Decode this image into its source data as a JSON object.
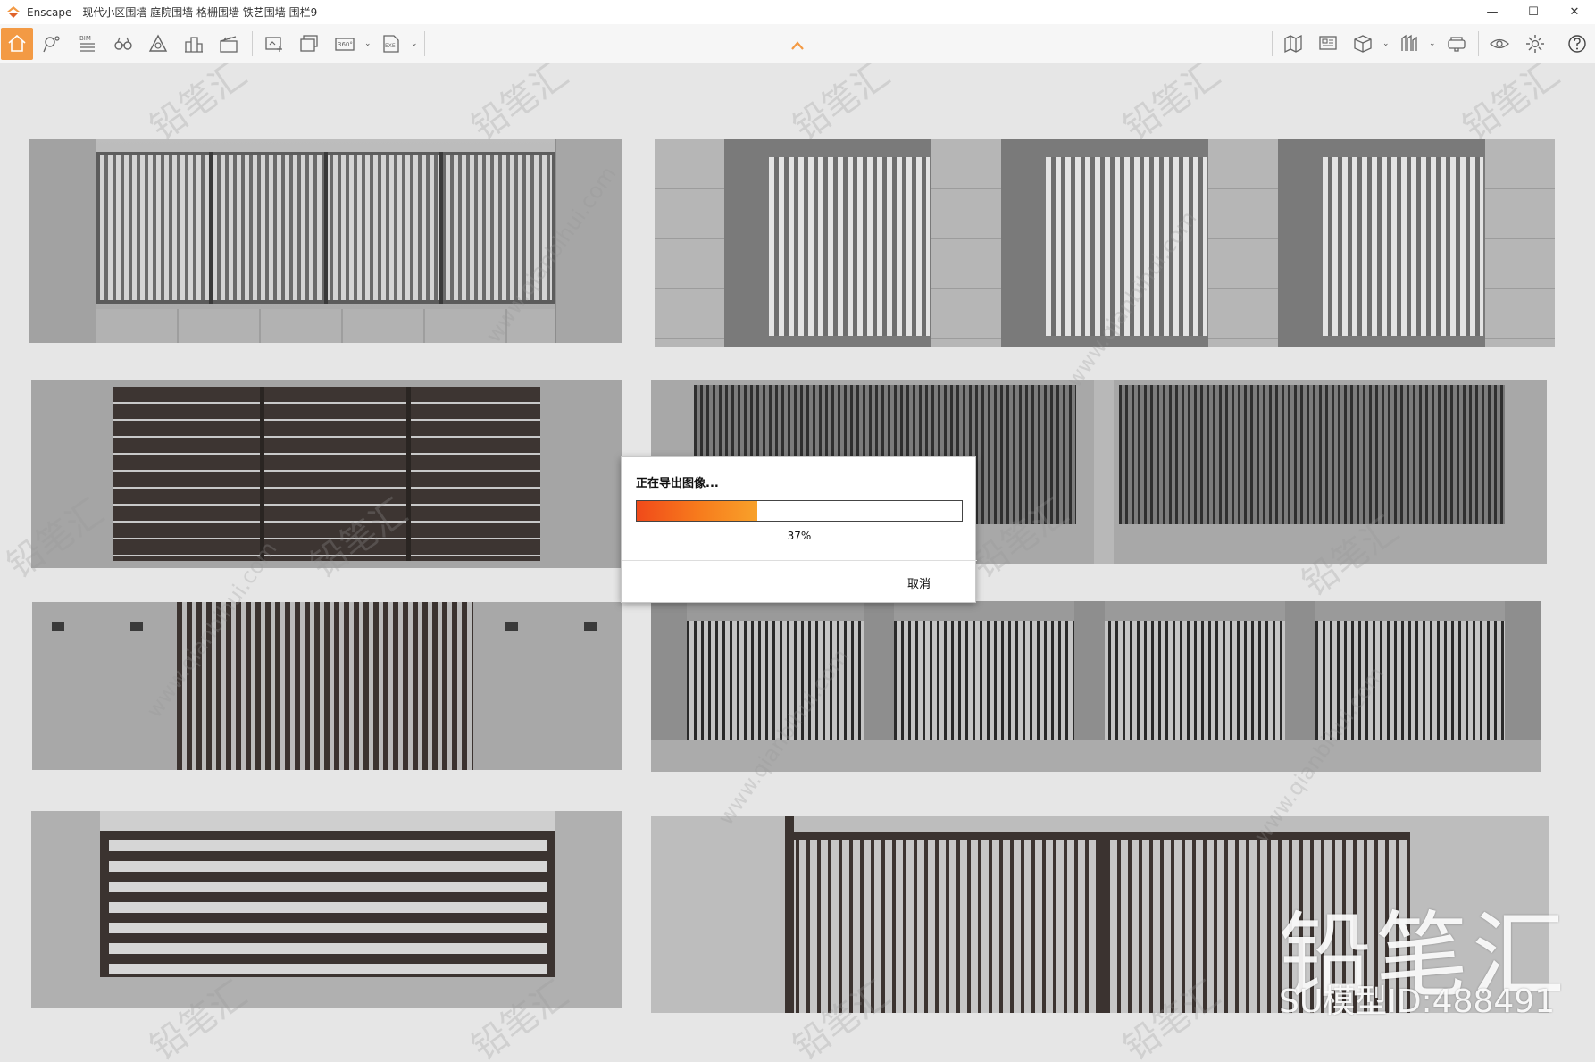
{
  "window": {
    "title": "Enscape - 现代小区围墙 庭院围墙 格栅围墙 铁艺围墙 围栏9",
    "minimize": "—",
    "maximize": "☐",
    "close": "✕"
  },
  "toolbar": {
    "bim_label": "BIM",
    "items_left": [
      "home-icon",
      "location-pin-icon",
      "bim-list-icon",
      "binoculars-icon",
      "asset-library-icon",
      "buildings-icon",
      "video-editor-icon",
      "screenshot-icon",
      "batch-render-icon",
      "panorama-360-icon",
      "export-exe-icon"
    ],
    "panorama_label": "360°",
    "exe_label": "EXE",
    "items_right": [
      "map-icon",
      "monitor-icon",
      "cube-icon",
      "materials-icon",
      "vr-headset-icon",
      "visibility-icon",
      "settings-icon",
      "help-icon"
    ]
  },
  "viewport": {
    "watermark_text": "铅笔汇",
    "watermark_url": "www.qianbihui.com",
    "brand_text": "铅笔汇",
    "model_id_text": "SU模型ID:488491"
  },
  "dialog": {
    "title": "正在导出图像...",
    "progress": 0.37,
    "progress_label": "37%",
    "cancel_label": "取消"
  },
  "colors": {
    "accent_orange": "#f39a44",
    "progress_start": "#f04a1a",
    "progress_end": "#f8a12a"
  }
}
